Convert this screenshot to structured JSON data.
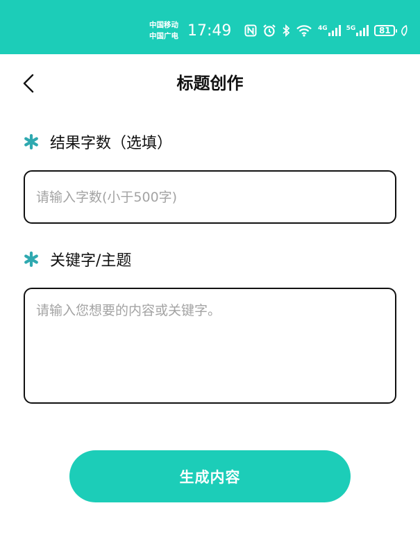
{
  "status_bar": {
    "carrier_1": "中国移动",
    "carrier_2": "中国广电",
    "time": "17:49",
    "network_1": "4G",
    "network_2": "5G",
    "battery": "81"
  },
  "header": {
    "title": "标题创作"
  },
  "form": {
    "word_count": {
      "label": "结果字数（选填）",
      "placeholder": "请输入字数(小于500字)",
      "value": ""
    },
    "keyword": {
      "label": "关键字/主题",
      "placeholder": "请输入您想要的内容或关键字。",
      "value": ""
    }
  },
  "actions": {
    "generate_label": "生成内容"
  },
  "colors": {
    "accent": "#1ccdb8",
    "star": "#2fa9b0",
    "border": "#111111",
    "placeholder": "#a3a3a3"
  }
}
